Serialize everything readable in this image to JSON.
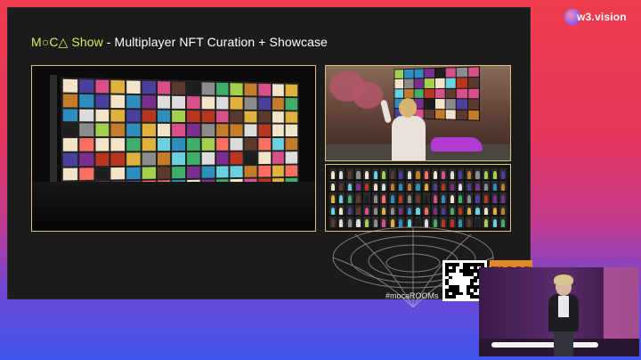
{
  "slide": {
    "title_brand": "M○C△ Show",
    "title_rest": " - Multiplayer NFT Curation + Showcase",
    "hashtag": "#mocaROOMs",
    "moca_logo": "mocα"
  },
  "watermark": {
    "logo_text": "w3.vision"
  },
  "colors": {
    "accent_title": "#d6f05a",
    "panel_border": "#d7c47a",
    "background_top": "#ef3d4e",
    "background_bottom": "#3f56ee"
  }
}
